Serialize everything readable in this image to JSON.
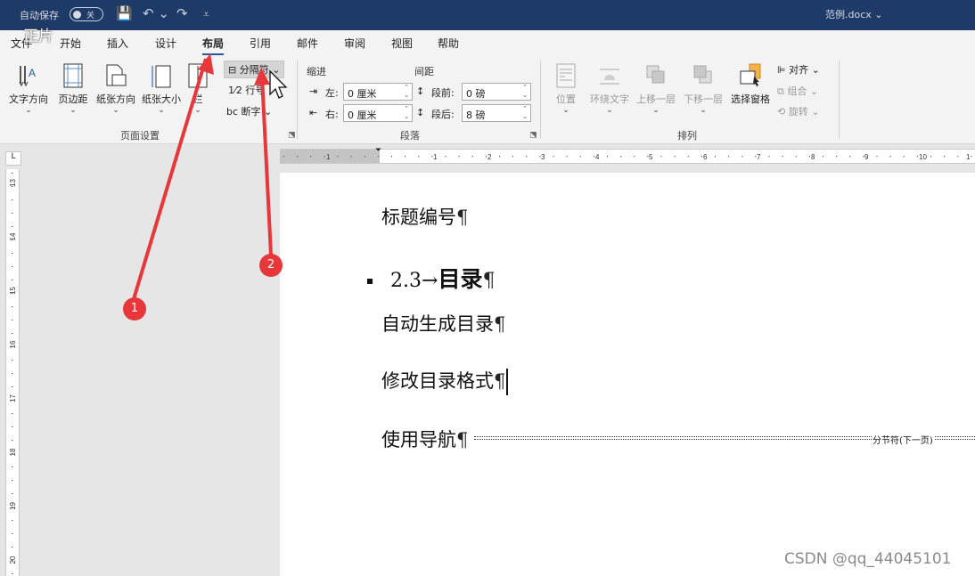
{
  "overlay_text": "正片",
  "titlebar": {
    "autosave_label": "自动保存",
    "autosave_state": "关",
    "filename": "范例.docx ⌄",
    "qa_save": "💾",
    "qa_undo": "↶ ⌄",
    "qa_redo": "↷",
    "qa_more": "⩡"
  },
  "tabs": [
    "文件",
    "开始",
    "插入",
    "设计",
    "布局",
    "引用",
    "邮件",
    "审阅",
    "视图",
    "帮助"
  ],
  "active_tab": "布局",
  "ribbon": {
    "page_setup": {
      "buttons": [
        "文字方向",
        "页边距",
        "纸张方向",
        "纸张大小",
        "栏"
      ],
      "breaks": "分隔符 ⌄",
      "line_numbers": "行号",
      "hyphenation": "断字 ⌄",
      "label": "页面设置"
    },
    "paragraph": {
      "indent_head": "缩进",
      "spacing_head": "间距",
      "left_label": "左:",
      "right_label": "右:",
      "left_value": "0 厘米",
      "right_value": "0 厘米",
      "before_label": "段前:",
      "after_label": "段后:",
      "before_value": "0 磅",
      "after_value": "8 磅",
      "label": "段落"
    },
    "arrange": {
      "buttons": [
        "位置",
        "环绕文字",
        "上移一层",
        "下移一层",
        "选择窗格"
      ],
      "align": "对齐 ⌄",
      "group": "组合 ⌄",
      "rotate": "旋转 ⌄",
      "label": "排列"
    }
  },
  "ruler": {
    "corner": "L",
    "marks": [
      "1",
      "1",
      "1",
      "2",
      "3",
      "4",
      "5",
      "6",
      "7",
      "8",
      "9",
      "10",
      "1"
    ],
    "vmarks": [
      "13",
      "14",
      "15",
      "16",
      "17",
      "18",
      "19",
      "20"
    ]
  },
  "document": {
    "line1": "标题编号",
    "heading_number": "2.3",
    "heading_arrow": "→",
    "heading_title": "目录",
    "line2": "自动生成目录",
    "line3": "修改目录格式",
    "line4": "使用导航",
    "pilcrow": "¶",
    "section_break": "分节符(下一页)"
  },
  "markers": [
    "1",
    "2"
  ],
  "watermark": "CSDN @qq_44045101"
}
